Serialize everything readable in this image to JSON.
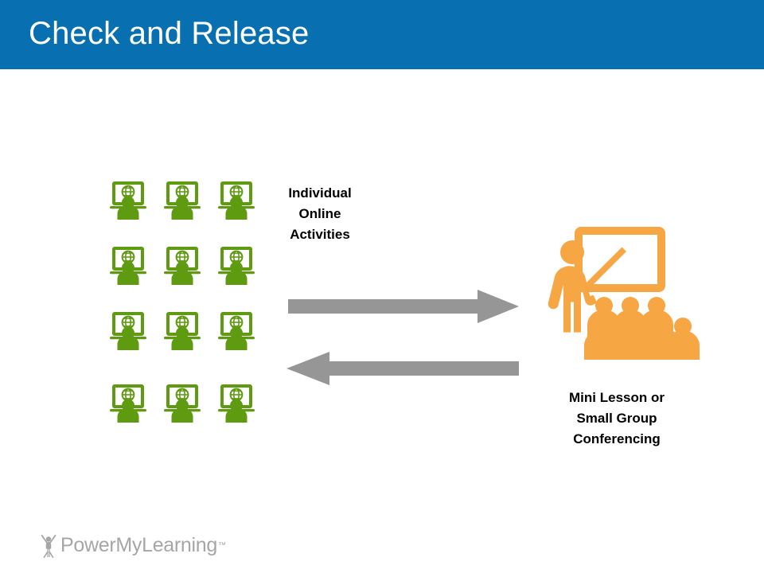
{
  "slide": {
    "title": "Check and Release",
    "banner_color": "#0870b0",
    "background_color": "#ffffff"
  },
  "colors": {
    "banner_blue": "#0870b0",
    "student_green": "#5f9b10",
    "teacher_orange": "#f7a644",
    "arrow_gray": "#969696",
    "logo_gray": "#a6a6a6",
    "label_black": "#000000"
  },
  "left_group": {
    "label": "Individual Online Activities",
    "label_lines": [
      "Individual",
      "Online",
      "Activities"
    ],
    "icon_name": "student-at-laptop-icon",
    "icon_count": 12,
    "grid_rows": 4,
    "grid_cols": 3
  },
  "arrows": {
    "top": {
      "direction": "right",
      "name": "arrow-right",
      "color": "#969696"
    },
    "bottom": {
      "direction": "left",
      "name": "arrow-left",
      "color": "#969696"
    }
  },
  "right_group": {
    "label": "Mini Lesson or Small Group Conferencing",
    "label_lines": [
      "Mini Lesson or",
      "Small Group",
      "Conferencing"
    ],
    "icon_name": "teacher-with-whiteboard-and-class-icon",
    "seated_students_back_row": 4,
    "seated_students_front_row": 3
  },
  "logo": {
    "text": "PowerMyLearning",
    "trademark": "™",
    "mark_name": "person-raised-arms-icon"
  }
}
